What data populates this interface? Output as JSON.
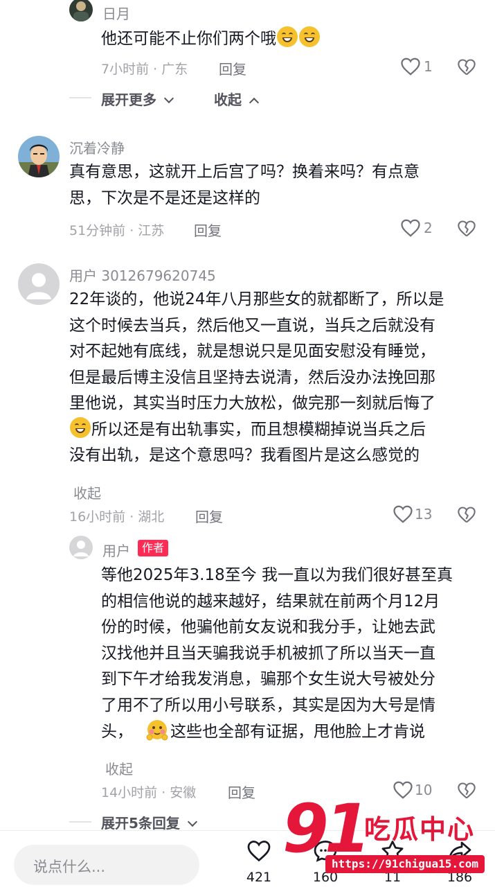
{
  "comments": [
    {
      "username": "日月",
      "text_line1_prefix": "他还可能不止你们两个哦",
      "meta": "7小时前 · 广东",
      "reply_label": "回复",
      "likes": "1",
      "expand_label": "展开更多",
      "collapse_label": "收起"
    },
    {
      "username": "沉着冷静",
      "lines": [
        "真有意思，这就开上后宫了吗？换着来吗？有点意",
        "思，下次是不是还是这样的"
      ],
      "meta": "51分钟前 · 江苏",
      "reply_label": "回复",
      "likes": "2"
    },
    {
      "username": "用户 3012679620745",
      "lines": [
        "22年谈的，他说24年八月那些女的就都断了，所以是",
        "这个时候去当兵，然后他又一直说，当兵之后就没有",
        "对不起她有底线，就是想说只是见面安慰没有睡觉，",
        "但是最后博主没信且坚持去说清，然后没办法挽回那",
        "里他说，其实当时压力大放松，做完那一刻就后悔了",
        "所以还是有出轨事实，而且想模糊掉说当兵之后",
        "没有出轨，是这个意思吗？我看图片是这么感觉的"
      ],
      "collapse_label": "收起",
      "meta": "16小时前 · 湖北",
      "reply_label": "回复",
      "likes": "13"
    },
    {
      "username": "用户",
      "tag": "作者",
      "lines": [
        "等他2025年3.18至今 我一直以为我们很好甚至真",
        "的相信他说的越来越好，结果就在前两个月12月",
        "份的时候，他骗他前女友说和我分手，让她去武",
        "汉找他并且当天骗我说手机被抓了所以当天一直",
        "到下午才给我发消息，骗那个女生说大号被处分",
        "了用不了所以用小号联系，其实是因为大号是情",
        "头，",
        "这些也全部有证据，甩他脸上才肯说"
      ],
      "collapse_label": "收起",
      "meta": "14小时前 · 安徽",
      "reply_label": "回复",
      "likes": "10",
      "expand_label": "展开5条回复"
    }
  ],
  "bottom_bar": {
    "input_placeholder": "说点什么...",
    "like_count": "421",
    "comment_count": "160",
    "star_count": "11",
    "share_count": "186"
  },
  "watermark": {
    "logo_digits": "91",
    "logo_text": "吃瓜中心",
    "url": "https://91chigua15.com"
  },
  "colors": {
    "accent": "#fe2c55",
    "text": "#161823",
    "muted": "#8a8b91"
  }
}
